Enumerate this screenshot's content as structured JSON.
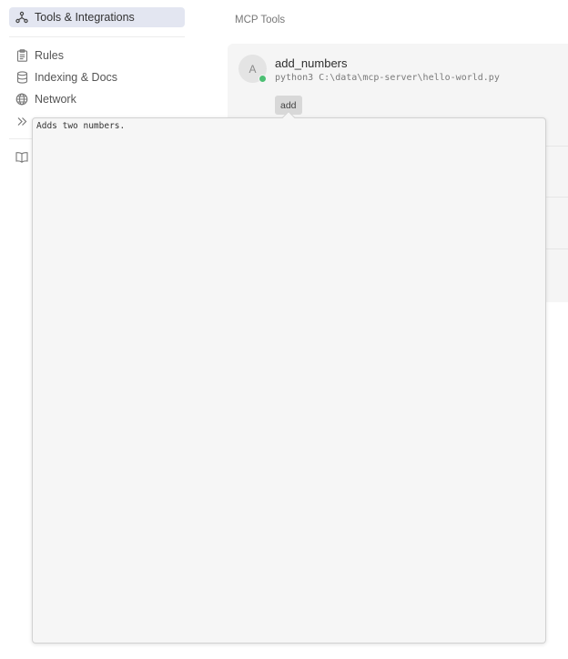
{
  "sidebar": {
    "items": [
      {
        "label": "Tools & Integrations",
        "icon": "integrations-icon",
        "active": true
      },
      {
        "label": "Rules",
        "icon": "clipboard-icon"
      },
      {
        "label": "Indexing & Docs",
        "icon": "database-icon"
      },
      {
        "label": "Network",
        "icon": "globe-icon"
      },
      {
        "label": "",
        "icon": "chevrons-right-icon"
      },
      {
        "label": "",
        "icon": "book-icon"
      }
    ]
  },
  "main": {
    "section_title": "MCP Tools",
    "servers": [
      {
        "avatar_letter": "A",
        "name": "add_numbers",
        "command": "python3 C:\\data\\mcp-server\\hello-world.py",
        "status_color": "#4cbf73",
        "tools": [
          "add"
        ]
      }
    ]
  },
  "tooltip": {
    "text": "Adds two numbers."
  },
  "colors": {
    "active_nav_bg": "#e3e6f1",
    "card_bg": "#f5f5f5",
    "status_ok": "#4cbf73"
  }
}
